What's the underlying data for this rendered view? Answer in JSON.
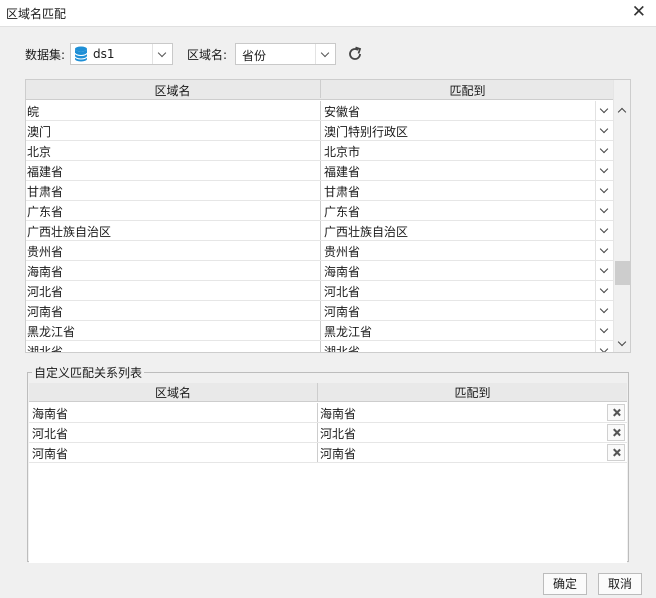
{
  "window": {
    "title": "区域名匹配"
  },
  "toolbar": {
    "dataset_label": "数据集:",
    "dataset_value": "ds1",
    "region_label": "区域名:",
    "region_value": "省份"
  },
  "match_table": {
    "col1": "区域名",
    "col2": "匹配到",
    "rows": [
      {
        "region": "皖",
        "match": "安徽省"
      },
      {
        "region": "澳门",
        "match": "澳门特别行政区"
      },
      {
        "region": "北京",
        "match": "北京市"
      },
      {
        "region": "福建省",
        "match": "福建省"
      },
      {
        "region": "甘肃省",
        "match": "甘肃省"
      },
      {
        "region": "广东省",
        "match": "广东省"
      },
      {
        "region": "广西壮族自治区",
        "match": "广西壮族自治区"
      },
      {
        "region": "贵州省",
        "match": "贵州省"
      },
      {
        "region": "海南省",
        "match": "海南省"
      },
      {
        "region": "河北省",
        "match": "河北省"
      },
      {
        "region": "河南省",
        "match": "河南省"
      },
      {
        "region": "黑龙江省",
        "match": "黑龙江省"
      },
      {
        "region": "湖北省",
        "match": "湖北省"
      }
    ]
  },
  "custom_group": {
    "title": "自定义匹配关系列表",
    "col1": "区域名",
    "col2": "匹配到",
    "rows": [
      {
        "region": "海南省",
        "match": "海南省"
      },
      {
        "region": "河北省",
        "match": "河北省"
      },
      {
        "region": "河南省",
        "match": "河南省"
      }
    ]
  },
  "buttons": {
    "ok": "确定",
    "cancel": "取消"
  },
  "icons": {
    "close": "close-icon",
    "database": "database-icon",
    "refresh": "refresh-icon",
    "delete": "delete-icon"
  },
  "colors": {
    "db_icon": "#1e8fd6"
  }
}
